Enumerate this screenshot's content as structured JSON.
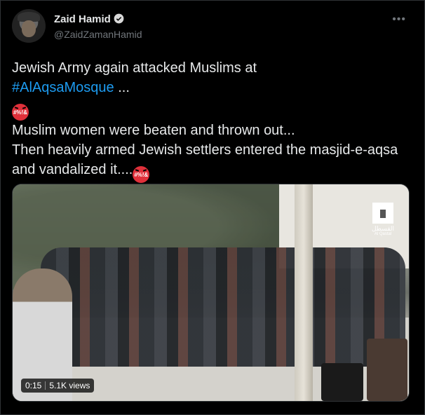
{
  "author": {
    "name": "Zaid Hamid",
    "handle": "@ZaidZamanHamid"
  },
  "tweet": {
    "line1": "Jewish Army again attacked Muslims at",
    "hashtag": "#AlAqsaMosque",
    "ellipsis": " ...",
    "emoji1": "#%!&",
    "line2": "Muslim women were beaten and thrown out...",
    "line3": "Then heavily armed Jewish settlers entered the masjid-e-aqsa and vandalized it....",
    "emoji2": "#%!&"
  },
  "media": {
    "watermark_ar": "القسطل",
    "watermark_en": "Al Qastal",
    "duration": "0:15",
    "views": "5.1K views"
  },
  "colors": {
    "link": "#1d9bf0",
    "background": "#000000",
    "verified": "#1d9bf0"
  }
}
